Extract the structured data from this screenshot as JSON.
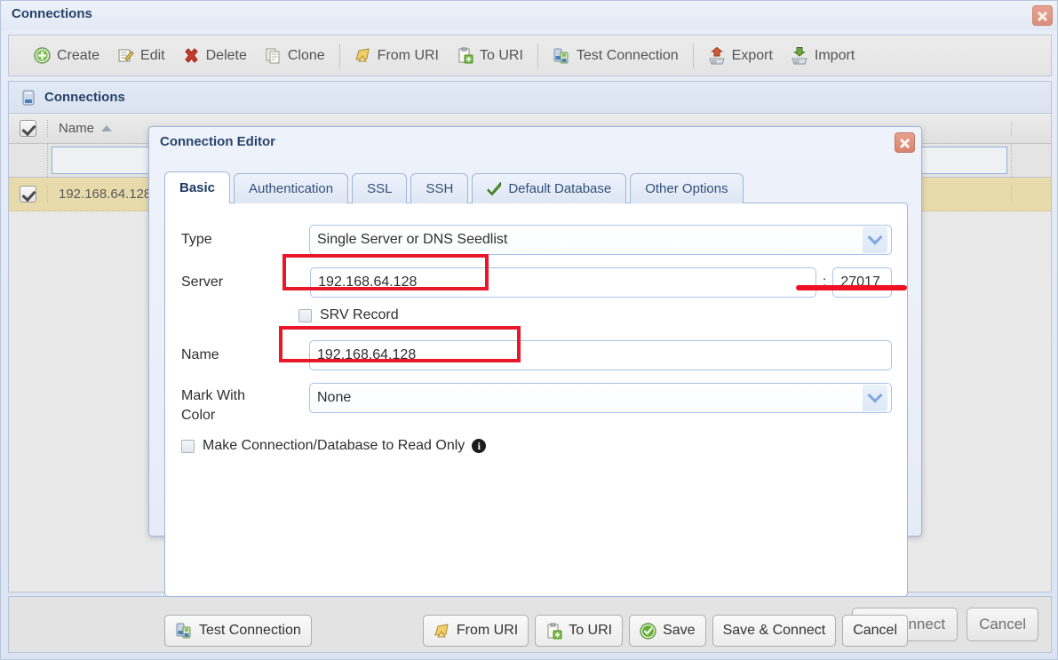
{
  "window": {
    "title": "Connections",
    "close_label": "Close"
  },
  "toolbar": {
    "items": [
      {
        "label": "Create",
        "icon": "plus-circle-icon"
      },
      {
        "label": "Edit",
        "icon": "edit-note-icon"
      },
      {
        "label": "Delete",
        "icon": "red-x-icon"
      },
      {
        "label": "Clone",
        "icon": "copy-page-icon"
      },
      {
        "label": "From URI",
        "icon": "import-uri-icon"
      },
      {
        "label": "To URI",
        "icon": "export-uri-icon"
      },
      {
        "label": "Test Connection",
        "icon": "server-test-icon"
      },
      {
        "label": "Export",
        "icon": "export-up-icon"
      },
      {
        "label": "Import",
        "icon": "import-down-icon"
      }
    ]
  },
  "panel": {
    "header": "Connections",
    "header_icon": "server-icon",
    "grid": {
      "columns": [
        "Name"
      ],
      "sort_column": "Name",
      "sort_direction": "ascending",
      "header_checkbox_checked": true,
      "filter_value": "",
      "rows": [
        {
          "checked": true,
          "name": "192.168.64.128",
          "selected": true
        }
      ]
    }
  },
  "bottom_bar": {
    "connect_label": "Connect",
    "connect_icon": "server-connect-icon",
    "cancel_label": "Cancel"
  },
  "dialog": {
    "title": "Connection Editor",
    "close_label": "Close",
    "tabs": [
      {
        "label": "Basic",
        "active": true,
        "icon": null
      },
      {
        "label": "Authentication",
        "active": false,
        "icon": null
      },
      {
        "label": "SSL",
        "active": false,
        "icon": null
      },
      {
        "label": "SSH",
        "active": false,
        "icon": null
      },
      {
        "label": "Default Database",
        "active": false,
        "icon": "green-check-icon"
      },
      {
        "label": "Other Options",
        "active": false,
        "icon": null
      }
    ],
    "form": {
      "type_label": "Type",
      "type_value": "Single Server or DNS Seedlist",
      "server_label": "Server",
      "server_value": "192.168.64.128",
      "port_separator": ":",
      "port_value": "27017",
      "srv_label": "SRV Record",
      "srv_checked": false,
      "name_label": "Name",
      "name_value": "192.168.64.128",
      "color_label_line1": "Mark With",
      "color_label_line2": "Color",
      "color_value": "None",
      "readonly_label": "Make Connection/Database to Read Only",
      "readonly_checked": false,
      "readonly_info_icon": "info-icon"
    },
    "footer": {
      "test_connection": "Test Connection",
      "from_uri": "From URI",
      "to_uri": "To URI",
      "save": "Save",
      "save_and_connect": "Save & Connect",
      "cancel": "Cancel"
    }
  },
  "annotations": {
    "accent_color": "#e8172a",
    "highlights": [
      {
        "target": "server-input",
        "shape": "rect"
      },
      {
        "target": "port-input",
        "shape": "underline"
      },
      {
        "target": "name-input",
        "shape": "rect"
      }
    ]
  }
}
